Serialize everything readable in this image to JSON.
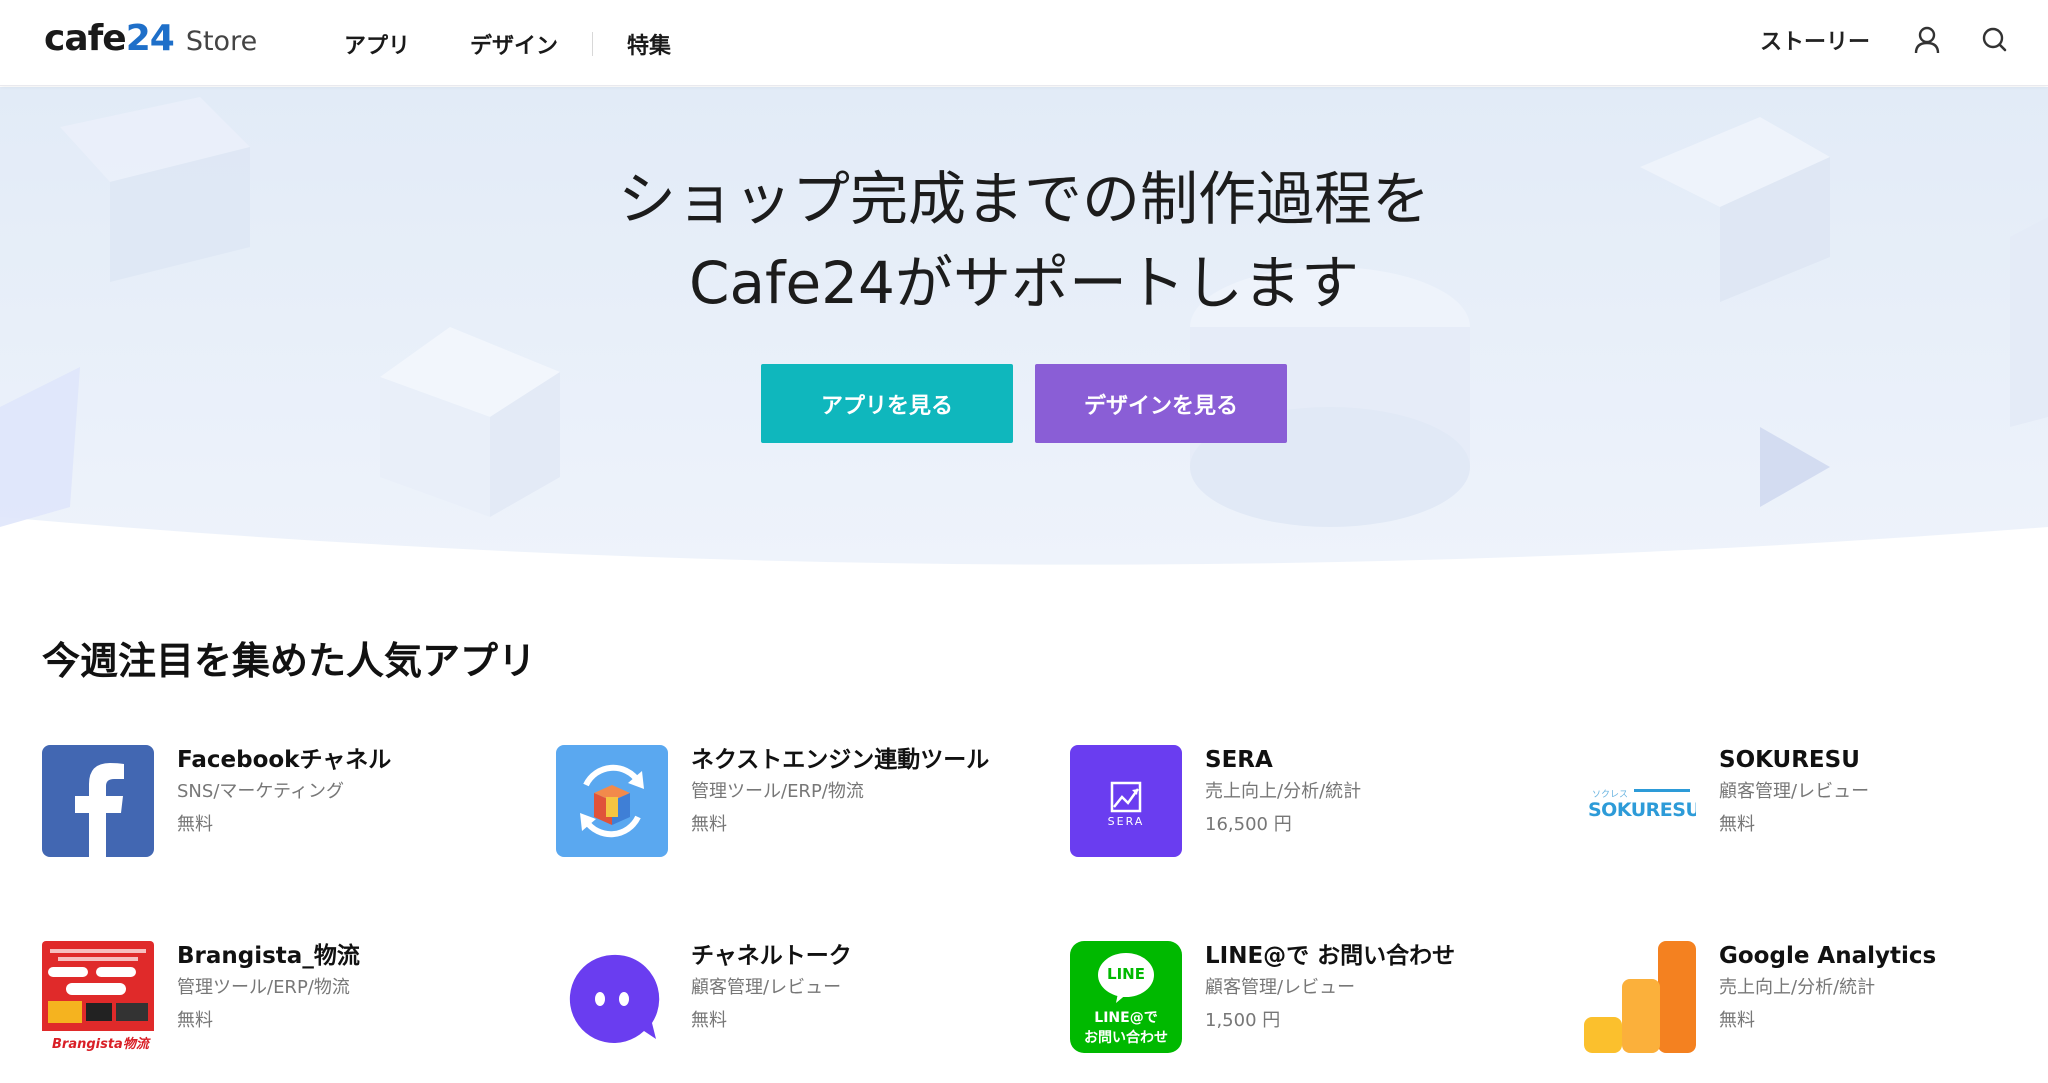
{
  "header": {
    "logo_main_a": "cafe",
    "logo_main_b": "24",
    "logo_sub": "Store",
    "nav": [
      {
        "label": "アプリ"
      },
      {
        "label": "デザイン"
      },
      {
        "label": "特集"
      }
    ],
    "story_label": "ストーリー",
    "icons": [
      "user-icon",
      "search-icon"
    ]
  },
  "hero": {
    "title_line1": "ショップ完成までの制作過程を",
    "title_line2": "Cafe24がサポートします",
    "btn_app": "アプリを見る",
    "btn_design": "デザインを見る",
    "colors": {
      "btn_app": "#0fb7bd",
      "btn_design": "#8a5ed6"
    }
  },
  "section": {
    "title": "今週注目を集めた人気アプリ"
  },
  "apps": [
    {
      "name": "Facebookチャネル",
      "category": "SNS/マーケティング",
      "price": "無料",
      "icon": "facebook-icon"
    },
    {
      "name": "ネクストエンジン連動ツール",
      "category": "管理ツール/ERP/物流",
      "price": "無料",
      "icon": "box-sync-icon"
    },
    {
      "name": "SERA",
      "category": "売上向上/分析/統計",
      "price": "16,500 円",
      "icon": "sera-logo-icon",
      "icon_text": "SERA"
    },
    {
      "name": "SOKURESU",
      "category": "顧客管理/レビュー",
      "price": "無料",
      "icon": "sokuresu-logo-icon",
      "icon_text": "SOKURESU",
      "icon_kana": "ソクレス"
    },
    {
      "name": "Brangista_物流",
      "category": "管理ツール/ERP/物流",
      "price": "無料",
      "icon": "brangista-logo-icon",
      "icon_text": "Brangista物流"
    },
    {
      "name": "チャネルトーク",
      "category": "顧客管理/レビュー",
      "price": "無料",
      "icon": "chat-bubble-icon"
    },
    {
      "name": "LINE@で お問い合わせ",
      "category": "顧客管理/レビュー",
      "price": "1,500 円",
      "icon": "line-icon",
      "icon_text": "LINE",
      "icon_sub1": "LINE@で",
      "icon_sub2": "お問い合わせ"
    },
    {
      "name": "Google Analytics",
      "category": "売上向上/分析/統計",
      "price": "無料",
      "icon": "analytics-bars-icon"
    }
  ]
}
